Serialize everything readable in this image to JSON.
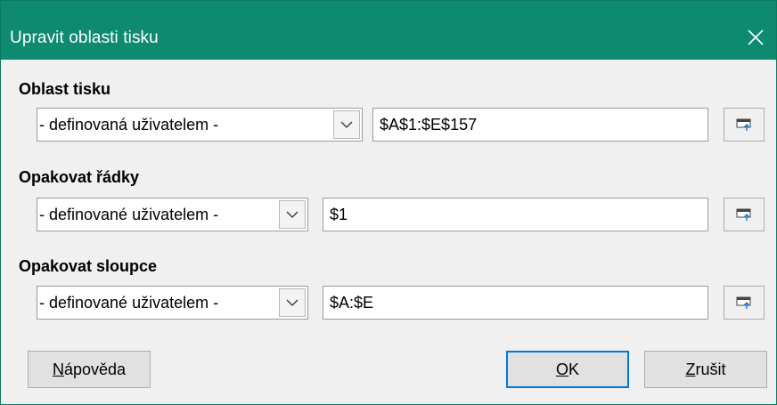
{
  "window": {
    "title": "Upravit oblasti tisku",
    "close_icon": "close-icon"
  },
  "print_range": {
    "label": "Oblast tisku",
    "dropdown_value": "- definovaná uživatelem -",
    "field_value": "$A$1:$E$157"
  },
  "repeat_rows": {
    "label": "Opakovat řádky",
    "dropdown_value": "- definované uživatelem -",
    "field_value": "$1"
  },
  "repeat_columns": {
    "label": "Opakovat sloupce",
    "dropdown_value": "- definované uživatelem -",
    "field_value": "$A:$E"
  },
  "buttons": {
    "help": {
      "mnemonic": "N",
      "rest": "ápověda"
    },
    "ok": {
      "mnemonic": "O",
      "rest": "K"
    },
    "cancel": {
      "mnemonic": "Z",
      "rest": "rušit"
    }
  },
  "colors": {
    "titlebar": "#0d8a6f",
    "default_button_border": "#0078d7"
  }
}
